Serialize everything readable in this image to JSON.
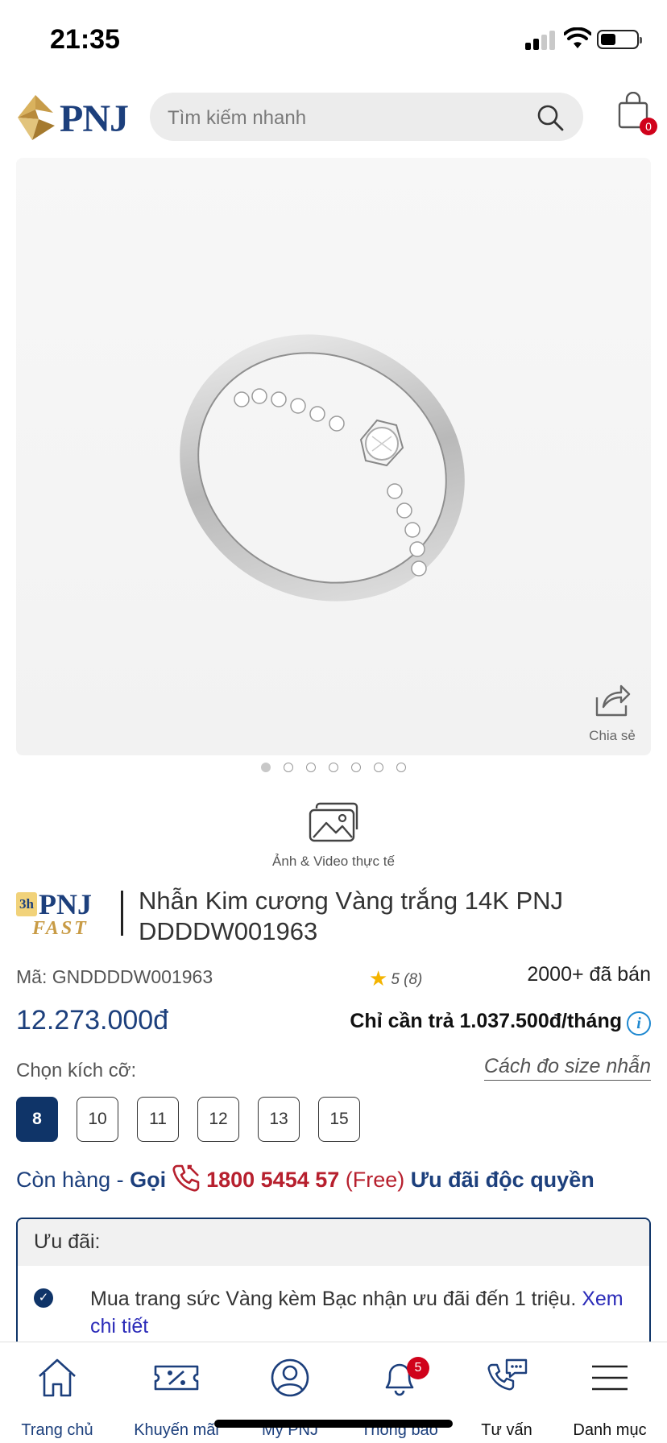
{
  "status_bar": {
    "time": "21:35"
  },
  "header": {
    "logo_text": "PNJ",
    "search_placeholder": "Tìm kiếm nhanh",
    "cart_count": "0"
  },
  "gallery": {
    "share_label": "Chia sẻ",
    "dots_total": 7,
    "active_dot": 1,
    "media_label": "Ảnh & Video thực tế"
  },
  "product": {
    "fast_badge": {
      "tag": "3h",
      "brand": "PNJ",
      "word": "FAST"
    },
    "title": "Nhẫn Kim cương Vàng trắng 14K PNJ DDDDW001963",
    "sku": "Mã: GNDDDDW001963",
    "rating": "5 (8)",
    "sold": "2000+ đã bán",
    "price": "12.273.000đ",
    "installment": "Chỉ cần trả 1.037.500đ/tháng",
    "choose_size_label": "Chọn kích cỡ:",
    "size_guide": "Cách đo size nhẫn",
    "sizes": [
      "8",
      "10",
      "11",
      "12",
      "13",
      "15"
    ],
    "selected_size": "8",
    "stock": {
      "status": "Còn hàng - ",
      "call": "Gọi",
      "phone": "1800 5454 57",
      "free": " (Free) ",
      "exclusive": "Ưu đãi độc quyền"
    }
  },
  "promo": {
    "heading": "Ưu đãi:",
    "item_text": "Mua trang sức Vàng kèm Bạc nhận ưu đãi đến 1 triệu. ",
    "item_link": "Xem chi tiết"
  },
  "bottom_nav": {
    "items": [
      {
        "label": "Trang chủ",
        "icon": "home-icon"
      },
      {
        "label": "Khuyến mãi",
        "icon": "coupon-icon"
      },
      {
        "label": "My PNJ",
        "icon": "user-icon"
      },
      {
        "label": "Thông báo",
        "icon": "bell-icon",
        "badge": "5"
      },
      {
        "label": "Tư vấn",
        "icon": "chat-phone-icon"
      },
      {
        "label": "Danh mục",
        "icon": "menu-icon"
      }
    ]
  },
  "colors": {
    "brand_navy": "#1c3f7c",
    "selected_size": "#0f3468",
    "red": "#d0021b",
    "phone_red": "#b7202e",
    "gold": "#c89b45"
  }
}
